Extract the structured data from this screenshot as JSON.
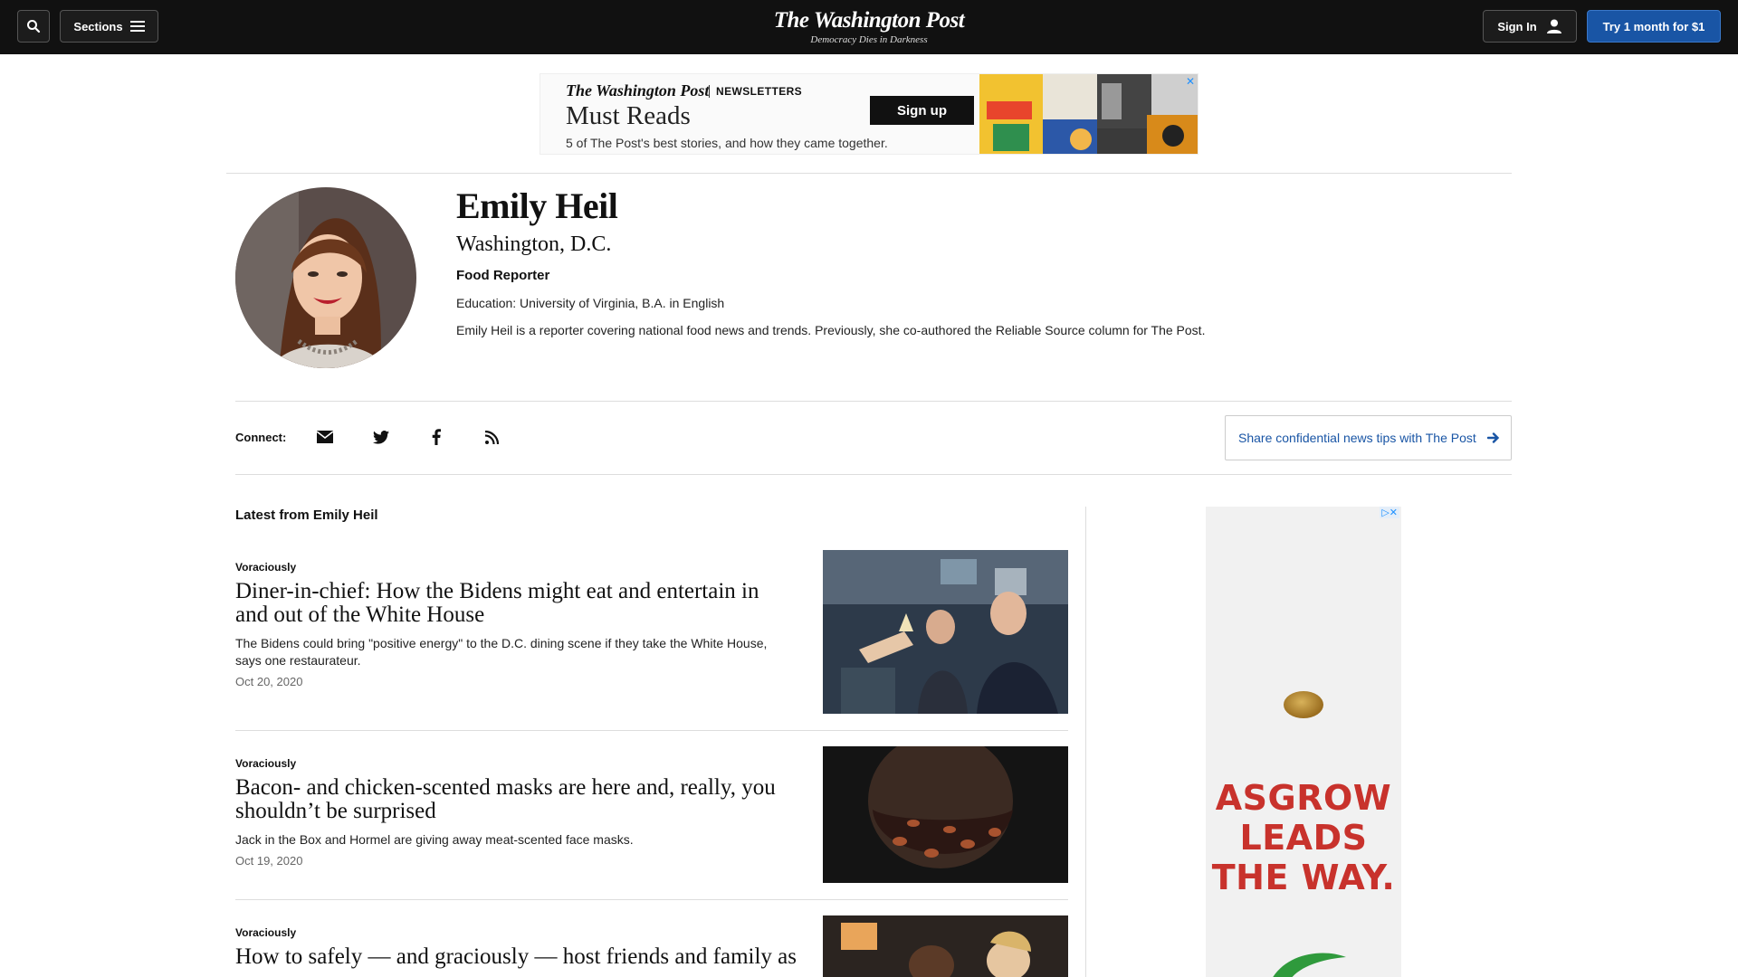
{
  "header": {
    "sections_label": "Sections",
    "logo": "The Washington Post",
    "tagline": "Democracy Dies in Darkness",
    "signin_label": "Sign In",
    "subscribe_label": "Try 1 month for $1"
  },
  "newsletter_ad": {
    "brand": "The Washington Post",
    "brand_sub": "NEWSLETTERS",
    "title": "Must Reads",
    "description": "5 of The Post's best stories, and how they came together.",
    "button_label": "Sign up"
  },
  "profile": {
    "name": "Emily Heil",
    "location": "Washington, D.C.",
    "role": "Food Reporter",
    "education": "Education: University of Virginia, B.A. in English",
    "bio": "Emily Heil is a reporter covering national food news and trends. Previously, she co-authored the Reliable Source column for The Post."
  },
  "connect": {
    "label": "Connect:",
    "icons": [
      "email-icon",
      "twitter-icon",
      "facebook-icon",
      "rss-icon"
    ],
    "tips_label": "Share confidential news tips with The Post"
  },
  "latest": {
    "title": "Latest from Emily Heil",
    "stories": [
      {
        "kicker": "Voraciously",
        "headline": "Diner-in-chief: How the Bidens might eat and entertain in and out of the White House",
        "blurb": "The Bidens could bring \"positive energy\" to the D.C. dining scene if they take the White House, says one restaurateur.",
        "date": "Oct 20, 2020"
      },
      {
        "kicker": "Voraciously",
        "headline": "Bacon- and chicken-scented masks are here and, really, you shouldn’t be surprised",
        "blurb": "Jack in the Box and Hormel are giving away meat-scented face masks.",
        "date": "Oct 19, 2020"
      },
      {
        "kicker": "Voraciously",
        "headline": "How to safely — and graciously — host friends and family as",
        "blurb": "",
        "date": ""
      }
    ]
  },
  "side_ad": {
    "text_line1": "ASGROW",
    "text_line2": "LEADS",
    "text_line3": "THE WAY."
  }
}
